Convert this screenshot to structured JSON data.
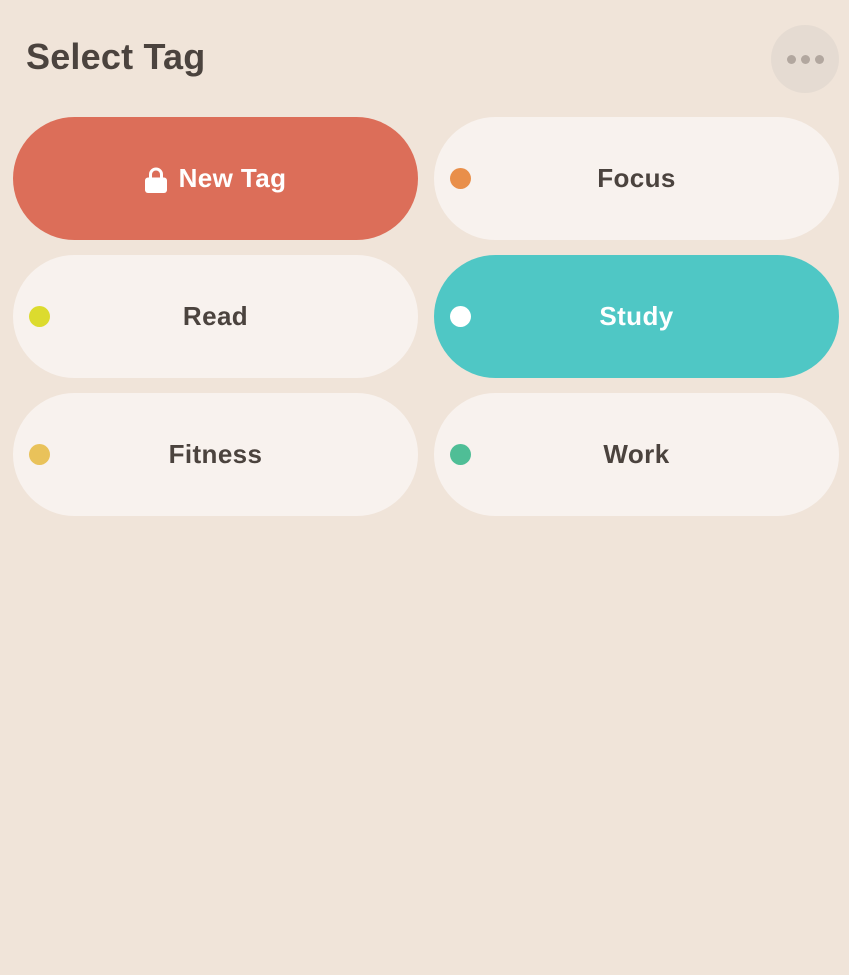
{
  "header": {
    "title": "Select Tag",
    "more_icon": "more-horizontal-icon"
  },
  "tags": [
    {
      "label": "New Tag",
      "icon": "lock-icon",
      "background": "#DC6E59",
      "locked": true
    },
    {
      "label": "Focus",
      "color": "#E98F4A"
    },
    {
      "label": "Read",
      "color": "#DCDB2E"
    },
    {
      "label": "Study",
      "color": "#FFFFFF",
      "selected": true,
      "background": "#4FC7C5"
    },
    {
      "label": "Fitness",
      "color": "#E9C25A"
    },
    {
      "label": "Work",
      "color": "#4FBE96"
    }
  ]
}
